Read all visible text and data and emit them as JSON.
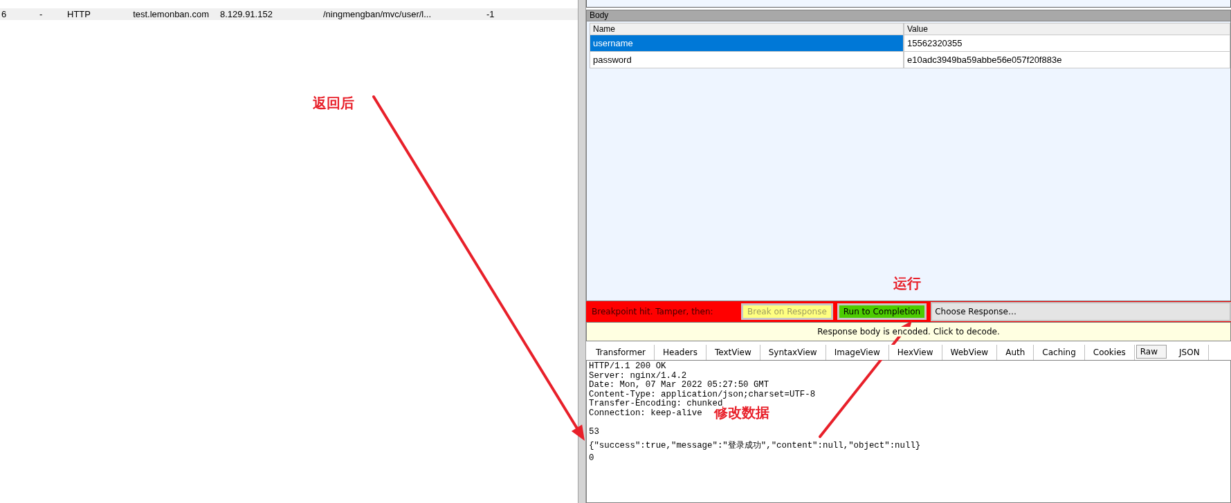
{
  "sessions": [
    {
      "cells": [
        "6",
        "-",
        "HTTP",
        "test.lemonban.com",
        "8.129.91.152",
        "/ningmengban/mvc/user/l...",
        "-1"
      ]
    }
  ],
  "body": {
    "title": "Body",
    "columns": [
      "Name",
      "Value"
    ],
    "rows": [
      {
        "name": "username",
        "value": "15562320355",
        "selected": true
      },
      {
        "name": "password",
        "value": "e10adc3949ba59abbe56e057f20f883e",
        "selected": false
      }
    ]
  },
  "breakpoint": {
    "label": "Breakpoint hit. Tamper, then:",
    "buttons": [
      {
        "label": "Break on Response",
        "kind": "break",
        "disabled": true
      },
      {
        "label": "Run to Completion",
        "kind": "run",
        "disabled": false
      }
    ],
    "choose": "Choose Response…"
  },
  "notice": "Response body is encoded. Click to decode.",
  "tabs": [
    {
      "label": "Transformer",
      "selected": false
    },
    {
      "label": "Headers",
      "selected": false
    },
    {
      "label": "TextView",
      "selected": false
    },
    {
      "label": "SyntaxView",
      "selected": false
    },
    {
      "label": "ImageView",
      "selected": false
    },
    {
      "label": "HexView",
      "selected": false
    },
    {
      "label": "WebView",
      "selected": false
    },
    {
      "label": "Auth",
      "selected": false
    },
    {
      "label": "Caching",
      "selected": false
    },
    {
      "label": "Cookies",
      "selected": false
    },
    {
      "label": "Raw",
      "selected": true
    },
    {
      "label": "JSON",
      "selected": false
    }
  ],
  "raw": {
    "headers": [
      "HTTP/1.1 200 OK",
      "Server: nginx/1.4.2",
      "Date: Mon, 07 Mar 2022 05:27:50 GMT",
      "Content-Type: application/json;charset=UTF-8",
      "Transfer-Encoding: chunked",
      "Connection: keep-alive"
    ],
    "chunk_size": "53",
    "json_body": "{\"success\":true,\"message\":\"登录成功\",\"content\":null,\"object\":null}",
    "terminator": "0"
  },
  "annotations": [
    {
      "text": "返回后"
    },
    {
      "text": "运行"
    },
    {
      "text": "修改数据"
    }
  ]
}
